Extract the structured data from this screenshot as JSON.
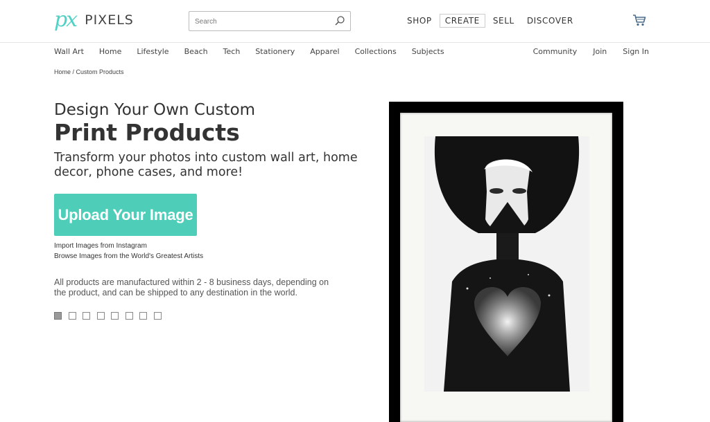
{
  "brand": {
    "mark": "px",
    "name": "PIXELS",
    "color": "#4fd1c5"
  },
  "search": {
    "placeholder": "Search"
  },
  "main_nav": [
    {
      "label": "SHOP",
      "active": false
    },
    {
      "label": "CREATE",
      "active": true
    },
    {
      "label": "SELL",
      "active": false
    },
    {
      "label": "DISCOVER",
      "active": false
    }
  ],
  "sub_nav": {
    "left": [
      "Wall Art",
      "Home",
      "Lifestyle",
      "Beach",
      "Tech",
      "Stationery",
      "Apparel",
      "Collections",
      "Subjects"
    ],
    "right": [
      "Community",
      "Join",
      "Sign In"
    ]
  },
  "breadcrumb": {
    "home": "Home",
    "separator": " / ",
    "current": "Custom Products"
  },
  "hero": {
    "line1": "Design Your Own Custom",
    "line2": "Print Products",
    "subtitle": "Transform your photos into custom wall art, home decor, phone cases, and more!"
  },
  "upload_button": {
    "label": "Upload Your Image",
    "color": "#4ecdb8"
  },
  "links": {
    "instagram": "Import Images from Instagram",
    "browse": "Browse Images from the World's Greatest Artists"
  },
  "note": "All products are manufactured within 2 - 8 business days, depending on the product, and can be shipped to any destination in the world.",
  "carousel": {
    "total": 8,
    "active_index": 0
  },
  "icons": {
    "search": "search-icon",
    "cart": "cart-icon"
  }
}
